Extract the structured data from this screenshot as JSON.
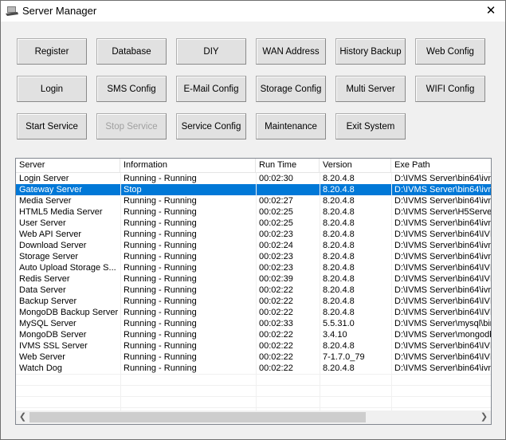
{
  "window": {
    "title": "Server Manager",
    "close_icon": "close-icon"
  },
  "buttons": [
    {
      "label": "Register",
      "enabled": true
    },
    {
      "label": "Database",
      "enabled": true
    },
    {
      "label": "DIY",
      "enabled": true
    },
    {
      "label": "WAN Address",
      "enabled": true
    },
    {
      "label": "History Backup",
      "enabled": true
    },
    {
      "label": "Web Config",
      "enabled": true
    },
    {
      "label": "Login",
      "enabled": true
    },
    {
      "label": "SMS Config",
      "enabled": true
    },
    {
      "label": "E-Mail Config",
      "enabled": true
    },
    {
      "label": "Storage Config",
      "enabled": true
    },
    {
      "label": "Multi Server",
      "enabled": true
    },
    {
      "label": "WIFI Config",
      "enabled": true
    },
    {
      "label": "Start Service",
      "enabled": true
    },
    {
      "label": "Stop Service",
      "enabled": false
    },
    {
      "label": "Service Config",
      "enabled": true
    },
    {
      "label": "Maintenance",
      "enabled": true
    },
    {
      "label": "Exit System",
      "enabled": true
    }
  ],
  "table": {
    "columns": [
      "Server",
      "Information",
      "Run Time",
      "Version",
      "Exe Path"
    ],
    "selected_row": 1,
    "rows": [
      [
        "Login Server",
        "Running - Running",
        "00:02:30",
        "8.20.4.8",
        "D:\\IVMS Server\\bin64\\ivn"
      ],
      [
        "Gateway Server",
        "Stop",
        "",
        "8.20.4.8",
        "D:\\IVMS Server\\bin64\\ivn"
      ],
      [
        "Media Server",
        "Running - Running",
        "00:02:27",
        "8.20.4.8",
        "D:\\IVMS Server\\bin64\\ivn"
      ],
      [
        "HTML5 Media Server",
        "Running - Running",
        "00:02:25",
        "8.20.4.8",
        "D:\\IVMS Server\\H5Serve"
      ],
      [
        "User Server",
        "Running - Running",
        "00:02:25",
        "8.20.4.8",
        "D:\\IVMS Server\\bin64\\ivn"
      ],
      [
        "Web API Server",
        "Running - Running",
        "00:02:23",
        "8.20.4.8",
        "D:\\IVMS Server\\bin64\\IVI"
      ],
      [
        "Download Server",
        "Running - Running",
        "00:02:24",
        "8.20.4.8",
        "D:\\IVMS Server\\bin64\\ivn"
      ],
      [
        "Storage Server",
        "Running - Running",
        "00:02:23",
        "8.20.4.8",
        "D:\\IVMS Server\\bin64\\ivn"
      ],
      [
        "Auto Upload Storage S...",
        "Running - Running",
        "00:02:23",
        "8.20.4.8",
        "D:\\IVMS Server\\bin64\\IVI"
      ],
      [
        "Redis Server",
        "Running - Running",
        "00:02:39",
        "8.20.4.8",
        "D:\\IVMS Server\\bin64\\IVI"
      ],
      [
        "Data Server",
        "Running - Running",
        "00:02:22",
        "8.20.4.8",
        "D:\\IVMS Server\\bin64\\ivn"
      ],
      [
        "Backup Server",
        "Running - Running",
        "00:02:22",
        "8.20.4.8",
        "D:\\IVMS Server\\bin64\\IVI"
      ],
      [
        "MongoDB Backup Server",
        "Running - Running",
        "00:02:22",
        "8.20.4.8",
        "D:\\IVMS Server\\bin64\\IVI"
      ],
      [
        "MySQL Server",
        "Running - Running",
        "00:02:33",
        "5.5.31.0",
        "D:\\IVMS Server\\mysql\\bir"
      ],
      [
        "MongoDB Server",
        "Running - Running",
        "00:02:22",
        "3.4.10",
        "D:\\IVMS Server\\mongodb"
      ],
      [
        "IVMS SSL Server",
        "Running - Running",
        "00:02:22",
        "8.20.4.8",
        "D:\\IVMS Server\\bin64\\IVI"
      ],
      [
        "Web Server",
        "Running - Running",
        "00:02:22",
        "7-1.7.0_79",
        "D:\\IVMS Server\\bin64\\IVI"
      ],
      [
        "Watch Dog",
        "Running - Running",
        "00:02:22",
        "8.20.4.8",
        "D:\\IVMS Server\\bin64\\ivn"
      ]
    ]
  },
  "scrollbar": {
    "left_arrow": "‹",
    "right_arrow": "›",
    "position_fraction": 0
  },
  "colors": {
    "selection": "#0078d7",
    "window_bg": "#f0f0f0"
  }
}
